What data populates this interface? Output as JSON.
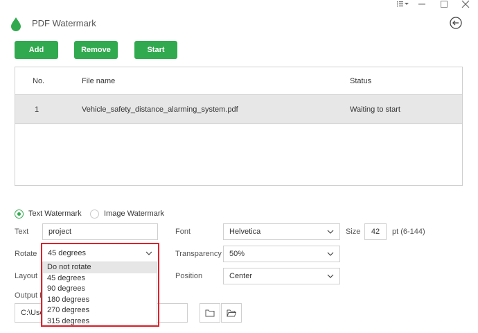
{
  "app": {
    "title": "PDF Watermark"
  },
  "window_controls": [
    "menu-icon",
    "minimize-icon",
    "maximize-icon",
    "close-icon"
  ],
  "toolbar": {
    "add_label": "Add",
    "remove_label": "Remove",
    "start_label": "Start"
  },
  "table": {
    "headers": {
      "no": "No.",
      "file_name": "File name",
      "status": "Status"
    },
    "rows": [
      {
        "no": "1",
        "file_name": "Vehicle_safety_distance_alarming_system.pdf",
        "status": "Waiting to start"
      }
    ]
  },
  "watermark_type": {
    "text_label": "Text Watermark",
    "image_label": "Image Watermark",
    "selected": "text"
  },
  "form": {
    "text_label": "Text",
    "text_value": "project",
    "font_label": "Font",
    "font_value": "Helvetica",
    "size_label": "Size",
    "size_value": "42",
    "size_hint": "pt (6-144)",
    "rotate_label": "Rotate",
    "rotate_value": "45 degrees",
    "transparency_label": "Transparency",
    "transparency_value": "50%",
    "layout_label": "Layout",
    "position_label": "Position",
    "position_value": "Center",
    "output_label_partial": "Output F",
    "output_value_partial": "C:\\Use"
  },
  "rotate_dropdown": {
    "options": [
      "Do not rotate",
      "45 degrees",
      "90 degrees",
      "180 degrees",
      "270 degrees",
      "315 degrees"
    ],
    "hovered_index": 0
  },
  "colors": {
    "accent": "#31aa4f",
    "highlight_border": "#e0202a"
  }
}
